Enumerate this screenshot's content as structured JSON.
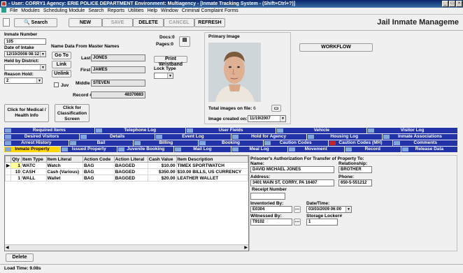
{
  "window": {
    "title": "- User: CORRY1  Agency: ERIE POLICE DEPARTMENT Environment: Multiagency - [Inmate Tracking System - (Shift+Ctrl+?)]"
  },
  "menu": [
    "File",
    "Modules",
    "Scheduling Module",
    "Search",
    "Reports",
    "Utilities",
    "Help",
    "Window",
    "Criminal Complaint Forms"
  ],
  "toolbar": {
    "search": "Search",
    "new": "NEW",
    "save": "SAVE",
    "delete": "DELETE",
    "cancel": "CANCEL",
    "refresh": "REFRESH"
  },
  "app_title": "Jail Inmate Manageme",
  "form": {
    "inmate_number_label": "Inmate Number",
    "inmate_number": "105",
    "date_intake_label": "Date of Intake",
    "date_intake": "12/10/2008 08:12",
    "held_by_label": "Held by District:",
    "held_by": "",
    "reason_hold_label": "Reason Hold:",
    "reason_hold": "2",
    "master_names_label": "Name Data From Master Names",
    "goto": "Go To",
    "link": "Link",
    "unlink": "Unlink",
    "last_label": "Last",
    "last": "JONES",
    "first_label": "First",
    "first": "JAMES",
    "middle_label": "Middle",
    "middle": "STEVEN",
    "juv_label": "Juv",
    "record_label": "Record #",
    "record": "48370883",
    "docs_label": "Docs:",
    "docs": "0",
    "pages_label": "Pages:",
    "pages": "0",
    "print_wristband": "Print Wristband",
    "lock_type_label": "Lock Type",
    "lock_type": "",
    "primary_image_label": "Primary Image",
    "total_images_label": "Total images on file:",
    "total_images": "6",
    "image_created_label": "Image created on:",
    "image_created": "11/19/2007",
    "workflow": "WORKFLOW",
    "click_medical": "Click for Medical / Health Info",
    "click_class": "Click for Classification Screen"
  },
  "tabs": [
    [
      "Required Items",
      "Telephone Log",
      "User Fields",
      "Vehicle",
      "Visitor Log"
    ],
    [
      "Desired Visitors",
      "Details",
      "Event Log",
      "Hold for Agency",
      "Housing Log",
      "Inmate Associations"
    ],
    [
      "Arrest History",
      "Bail",
      "Billing",
      "Booking",
      "Caution Codes",
      "Caution Codes (MH)",
      "Comments"
    ],
    [
      "Inmate Property",
      "Issued Property",
      "Juvenile Booking",
      "Mail Log",
      "Meal Log",
      "Movement",
      "Record",
      "Release Data"
    ]
  ],
  "grid": {
    "headers": [
      "Qty",
      "Item Type",
      "Item Literal",
      "Action Code",
      "Action Literal",
      "Cash Value",
      "Item Description"
    ],
    "rows": [
      [
        "1",
        "WATC",
        "Watch",
        "BAG",
        "BAGGED",
        "$10.00",
        "TIMEX SPORTWATCH"
      ],
      [
        "10",
        "CASH",
        "Cash (Various)",
        "BAG",
        "BAGGED",
        "$350.00",
        "$10.00 BILLS, US CURRENCY"
      ],
      [
        "1",
        "WALL",
        "Wallet",
        "BAG",
        "BAGGED",
        "$20.00",
        "LEATHER WALLET"
      ]
    ]
  },
  "transfer": {
    "title": "Prisoner's Authorization For Transfer of Property To:",
    "name_label": "Name:",
    "name": "DAVID MICHAEL JONES",
    "rel_label": "Relationship:",
    "rel": "BROTHER",
    "addr_label": "Address:",
    "addr": "3401 MAIN ST, CORRY, PA 16407",
    "phone_label": "Phone:",
    "phone": "650-5-551212",
    "receipt_label": "Receipt Number",
    "receipt": "",
    "inv_by_label": "Inventoried By:",
    "inv_by": "E0304",
    "datetime_label": "Date/Time:",
    "datetime": "03/03/2009 06:00",
    "witness_label": "Witnessed By:",
    "witness": "T9102",
    "locker_label": "Storage Locker#",
    "locker": "1"
  },
  "delete_btn": "Delete",
  "status": "Load Time: 9.08s"
}
